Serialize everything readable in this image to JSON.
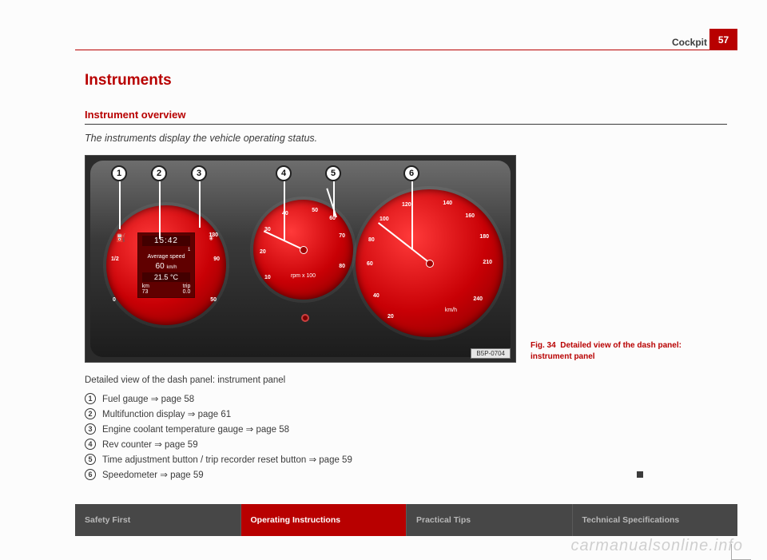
{
  "header": {
    "section": "Cockpit",
    "page": "57"
  },
  "title": "Instruments",
  "subtitle": "Instrument overview",
  "intro": "The instruments display the vehicle operating status.",
  "figure": {
    "id": "B5P-0704",
    "caption_lead": "Fig. 34",
    "caption_text": "Detailed view of the dash panel: instrument panel",
    "callouts": [
      "1",
      "2",
      "3",
      "4",
      "5",
      "6"
    ],
    "mfd": {
      "time": "15:42",
      "label": "Average speed",
      "value": "60",
      "value_unit": "km/h",
      "temp": "21.5 °C",
      "bottom_left_label": "km",
      "bottom_left": "73",
      "bottom_right_label": "trip",
      "bottom_right": "0.0",
      "top_right": "1"
    },
    "left_gauge": {
      "fuel_marks": [
        "0",
        "1/2",
        "1"
      ],
      "temp_marks": [
        "50",
        "90",
        "130"
      ]
    },
    "tacho": {
      "marks": [
        "10",
        "20",
        "30",
        "40",
        "50",
        "60",
        "70",
        "80"
      ],
      "unit": "rpm x 100"
    },
    "speedo": {
      "marks": [
        "20",
        "40",
        "60",
        "80",
        "100",
        "120",
        "140",
        "160",
        "180",
        "210",
        "240"
      ],
      "unit": "km/h"
    }
  },
  "detail_line": "Detailed view of the dash panel: instrument panel",
  "legend": [
    {
      "n": "1",
      "text": "Fuel gauge ⇒ page 58"
    },
    {
      "n": "2",
      "text": "Multifunction display ⇒ page 61"
    },
    {
      "n": "3",
      "text": "Engine coolant temperature gauge ⇒ page 58"
    },
    {
      "n": "4",
      "text": "Rev counter ⇒ page 59"
    },
    {
      "n": "5",
      "text": "Time adjustment button / trip recorder reset button ⇒ page 59"
    },
    {
      "n": "6",
      "text": "Speedometer ⇒ page 59"
    }
  ],
  "footer": [
    "Safety First",
    "Operating Instructions",
    "Practical Tips",
    "Technical Specifications"
  ],
  "watermark": "carmanualsonline.info"
}
